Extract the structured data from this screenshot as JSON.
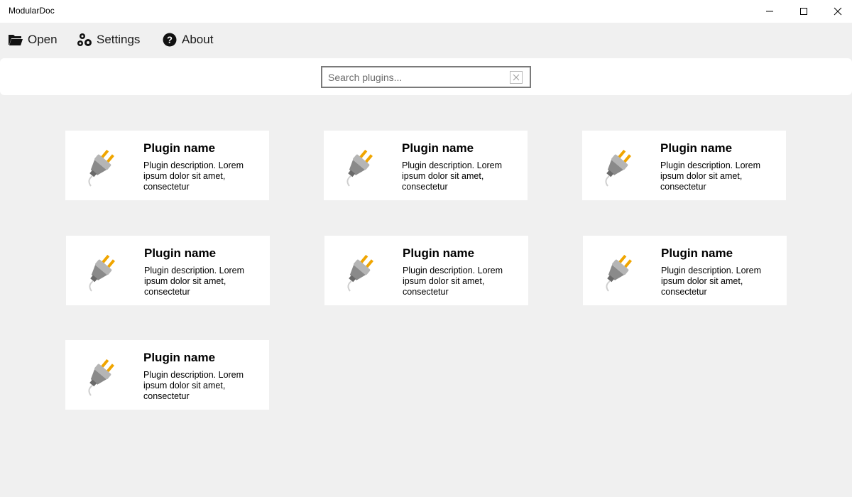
{
  "window": {
    "title": "ModularDoc"
  },
  "menu": {
    "open_label": "Open",
    "settings_label": "Settings",
    "about_label": "About"
  },
  "search": {
    "placeholder": "Search plugins...",
    "value": ""
  },
  "plugins": [
    {
      "name": "Plugin name",
      "description": "Plugin description. Lorem ipsum dolor sit amet, consectetur",
      "icon": "plug-icon"
    },
    {
      "name": "Plugin name",
      "description": "Plugin description. Lorem ipsum dolor sit amet, consectetur",
      "icon": "plug-icon"
    },
    {
      "name": "Plugin name",
      "description": "Plugin description. Lorem ipsum dolor sit amet, consectetur",
      "icon": "plug-icon"
    },
    {
      "name": "Plugin name",
      "description": "Plugin description. Lorem ipsum dolor sit amet, consectetur",
      "icon": "plug-icon"
    },
    {
      "name": "Plugin name",
      "description": "Plugin description. Lorem ipsum dolor sit amet, consectetur",
      "icon": "plug-icon"
    },
    {
      "name": "Plugin name",
      "description": "Plugin description. Lorem ipsum dolor sit amet, consectetur",
      "icon": "plug-icon"
    },
    {
      "name": "Plugin name",
      "description": "Plugin description. Lorem ipsum dolor sit amet, consectetur",
      "icon": "plug-icon"
    }
  ],
  "colors": {
    "background": "#f0f0f0",
    "surface": "#ffffff",
    "plug_body": "#8a8a8a",
    "plug_prongs": "#f0a500"
  }
}
